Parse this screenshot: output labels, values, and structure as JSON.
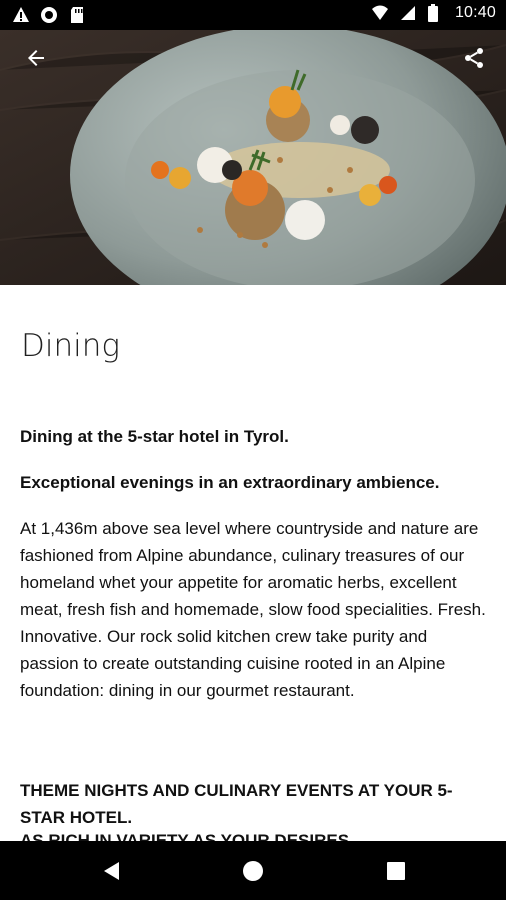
{
  "status_bar": {
    "time": "10:40",
    "icons": [
      "alert-icon",
      "circle-icon",
      "sd-card-icon",
      "wifi-icon",
      "signal-icon",
      "battery-icon"
    ]
  },
  "hero": {
    "image_description_name": "gourmet-dish-image"
  },
  "actions": {
    "back_icon": "arrow-left-icon",
    "share_icon": "share-icon"
  },
  "page": {
    "title": "Dining",
    "intro1": "Dining at the 5-star hotel in Tyrol.",
    "intro2": "Exceptional evenings in an extraordinary ambience.",
    "paragraph": "At 1,436m above sea level where countryside and nature are fashioned from Alpine abundance, culinary treasures of our homeland whet your appetite for aromatic herbs, excellent meat, fresh fish and homemade, slow food specialities. Fresh. Innovative. Our rock solid kitchen crew take purity and passion to create outstanding cuisine rooted in an Alpine foundation: dining in our gourmet restaurant.",
    "theme_heading": "THEME NIGHTS AND CULINARY EVENTS AT YOUR 5-STAR HOTEL.",
    "theme_subheading": "AS RICH IN VARIETY AS YOUR DESIRES"
  },
  "nav_bar": {
    "back_icon": "nav-back-icon",
    "home_icon": "nav-home-icon",
    "recent_icon": "nav-recent-icon"
  },
  "colors": {
    "status_bg": "#000000",
    "content_text": "#111111",
    "plate": "#8e9a97"
  }
}
